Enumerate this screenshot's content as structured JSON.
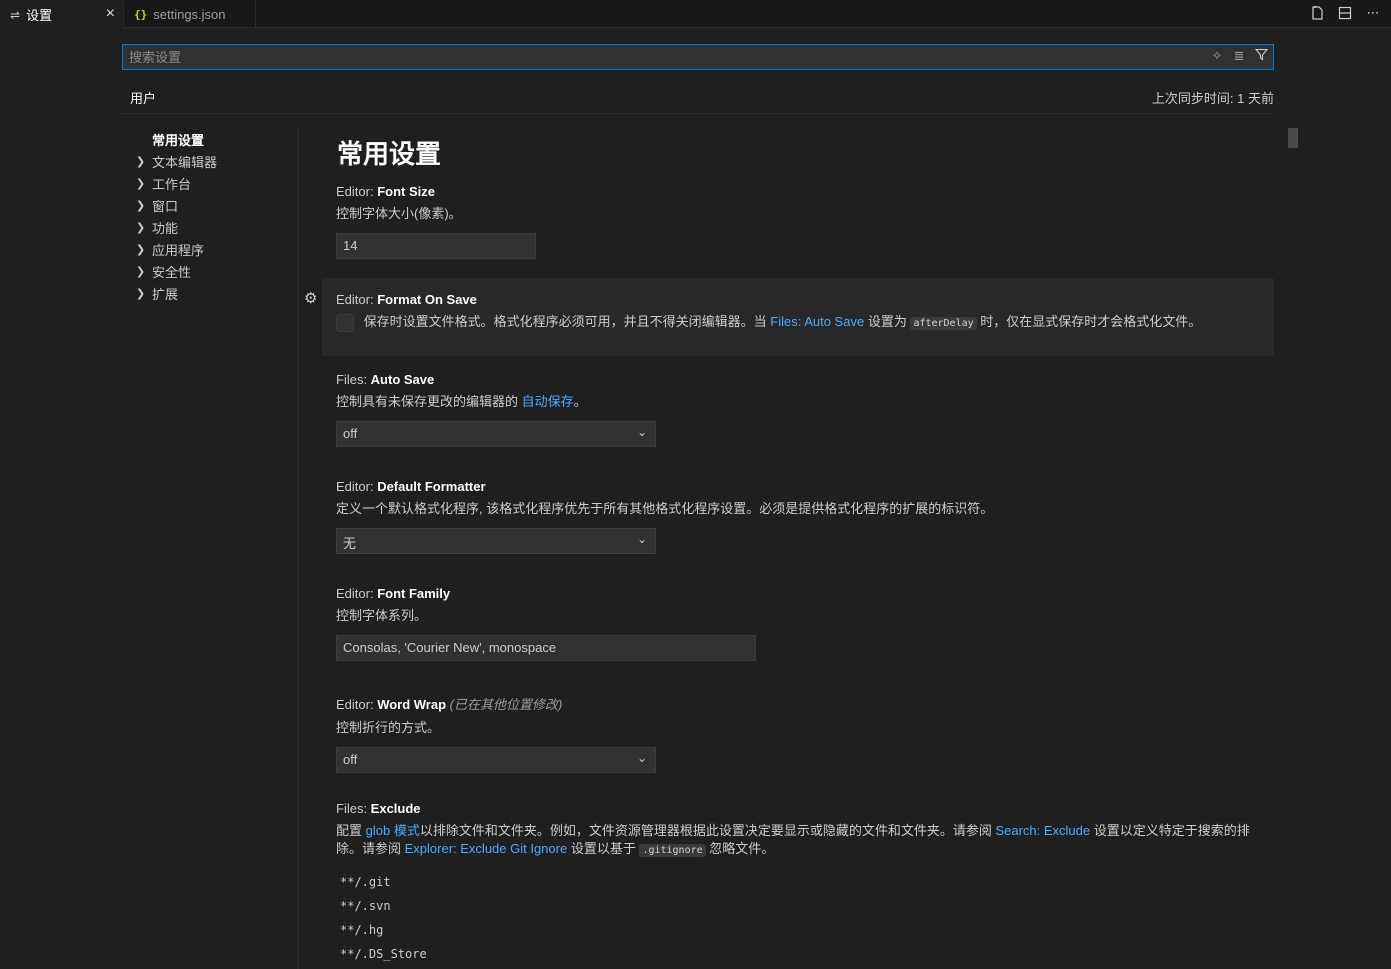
{
  "tabs": {
    "settings_label": "设置",
    "settings_icon": "settings-sliders-icon",
    "json_icon_glyph": "{}",
    "json_label": "settings.json"
  },
  "search": {
    "placeholder": "搜索设置"
  },
  "scope": {
    "user_tab": "用户",
    "sync_status": "上次同步时间: 1 天前"
  },
  "toc": {
    "head": "常用设置",
    "items": [
      "文本编辑器",
      "工作台",
      "窗口",
      "功能",
      "应用程序",
      "安全性",
      "扩展"
    ]
  },
  "section": {
    "title": "常用设置"
  },
  "settings": {
    "font_size": {
      "category": "Editor: ",
      "name": "Font Size",
      "desc": "控制字体大小(像素)。",
      "value": "14"
    },
    "format_on_save": {
      "category": "Editor: ",
      "name": "Format On Save",
      "desc_a": "保存时设置文件格式。格式化程序必须可用，并且不得关闭编辑器。当 ",
      "desc_link": "Files: Auto Save",
      "desc_b": " 设置为 ",
      "desc_code": "afterDelay",
      "desc_c": " 时，仅在显式保存时才会格式化文件。",
      "checked": false
    },
    "auto_save": {
      "category": "Files: ",
      "name": "Auto Save",
      "desc_a": "控制具有未保存更改的编辑器的 ",
      "desc_link": "自动保存",
      "desc_b": "。",
      "value": "off"
    },
    "default_formatter": {
      "category": "Editor: ",
      "name": "Default Formatter",
      "desc": "定义一个默认格式化程序, 该格式化程序优先于所有其他格式化程序设置。必须是提供格式化程序的扩展的标识符。",
      "value": "无"
    },
    "font_family": {
      "category": "Editor: ",
      "name": "Font Family",
      "desc": "控制字体系列。",
      "value": "Consolas, 'Courier New', monospace"
    },
    "word_wrap": {
      "category": "Editor: ",
      "name": "Word Wrap",
      "modified": "(已在其他位置修改)",
      "desc": "控制折行的方式。",
      "value": "off"
    },
    "exclude": {
      "category": "Files: ",
      "name": "Exclude",
      "desc_a": "配置 ",
      "desc_link1": "glob 模式",
      "desc_b": "以排除文件和文件夹。例如，文件资源管理器根据此设置决定要显示或隐藏的文件和文件夹。请参阅 ",
      "desc_link2": "Search: Exclude",
      "desc_c": " 设置以定义特定于搜索的排除。请参阅 ",
      "desc_link3": "Explorer: Exclude Git Ignore",
      "desc_d": " 设置以基于 ",
      "desc_code": ".gitignore",
      "desc_e": " 忽略文件。",
      "patterns": [
        "**/.git",
        "**/.svn",
        "**/.hg",
        "**/.DS_Store"
      ]
    }
  }
}
